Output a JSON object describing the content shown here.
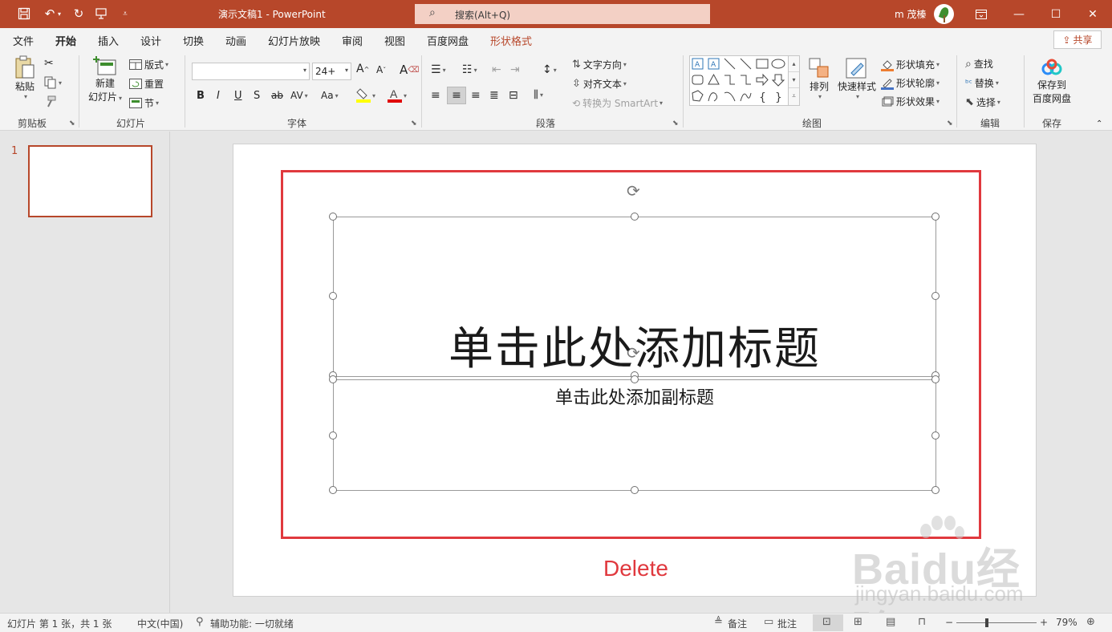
{
  "titlebar": {
    "doc_title": "演示文稿1  -  PowerPoint",
    "search_placeholder": "搜索(Alt+Q)",
    "user_name": "m 茂榛"
  },
  "ribbon_tabs": [
    "文件",
    "开始",
    "插入",
    "设计",
    "切换",
    "动画",
    "幻灯片放映",
    "审阅",
    "视图",
    "百度网盘",
    "形状格式"
  ],
  "active_tab": "开始",
  "share_label": "共享",
  "groups": {
    "clipboard": {
      "label": "剪贴板",
      "paste": "粘贴"
    },
    "slides": {
      "label": "幻灯片",
      "new_slide_line1": "新建",
      "new_slide_line2": "幻灯片",
      "layout": "版式",
      "reset": "重置",
      "section": "节"
    },
    "font": {
      "label": "字体",
      "font_name": "",
      "font_size": "24+"
    },
    "paragraph": {
      "label": "段落",
      "text_direction": "文字方向",
      "align_text": "对齐文本",
      "convert_smartart": "转换为 SmartArt"
    },
    "drawing": {
      "label": "绘图",
      "arrange": "排列",
      "quick_styles": "快速样式",
      "shape_fill": "形状填充",
      "shape_outline": "形状轮廓",
      "shape_effects": "形状效果"
    },
    "editing": {
      "label": "编辑",
      "find": "查找",
      "replace": "替换",
      "select": "选择"
    },
    "save": {
      "label": "保存",
      "line1": "保存到",
      "line2": "百度网盘"
    }
  },
  "thumbnails": [
    {
      "number": "1"
    }
  ],
  "slide": {
    "title_placeholder": "单击此处添加标题",
    "subtitle_placeholder": "单击此处添加副标题"
  },
  "annotation": {
    "text": "Delete",
    "color": "#e0393e"
  },
  "watermark": {
    "brand": "Baidu经验",
    "url": "jingyan.baidu.com"
  },
  "statusbar": {
    "slide_info": "幻灯片 第 1 张，共 1 张",
    "language": "中文(中国)",
    "accessibility": "辅助功能: 一切就绪",
    "notes": "备注",
    "comments": "批注",
    "zoom_minus": "−",
    "zoom_plus": "+",
    "zoom_level": "79%"
  },
  "colors": {
    "accent": "#b7472a",
    "annotation": "#e0393e"
  }
}
